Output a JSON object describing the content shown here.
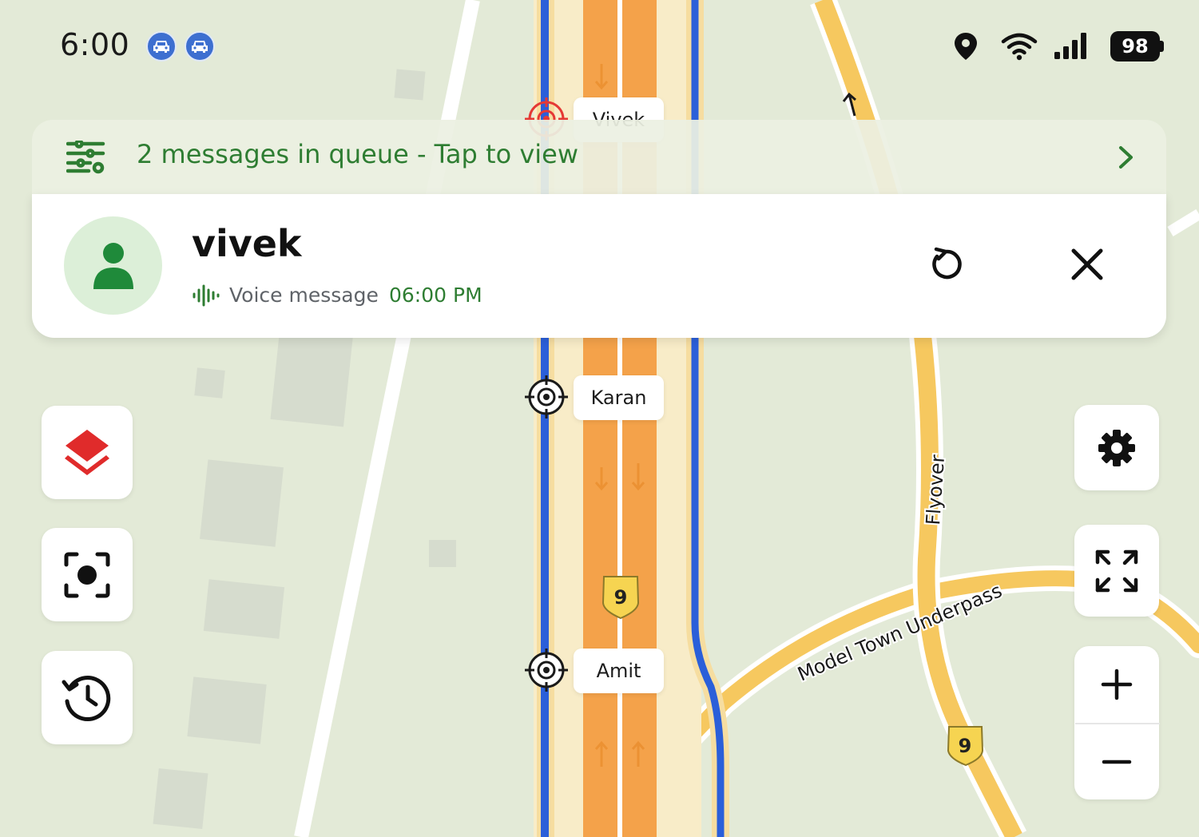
{
  "status_bar": {
    "time": "6:00",
    "notification_icons": [
      "car-icon",
      "car-icon"
    ],
    "battery_level": "98",
    "icons": [
      "location-pin-icon",
      "wifi-icon",
      "signal-icon",
      "battery-icon"
    ]
  },
  "map": {
    "markers": [
      {
        "name": "Vivek",
        "active": true
      },
      {
        "name": "Karan",
        "active": false
      },
      {
        "name": "Amit",
        "active": false
      }
    ],
    "road_labels": {
      "flyover": "Flyover",
      "underpass": "Model Town Underpass",
      "route_shield": "9"
    },
    "colors": {
      "land": "#e3ead7",
      "highway": "#f4a24a",
      "blue_edge": "#2b5fd9",
      "yellow_road": "#f6c85f",
      "active_marker": "#e53935"
    }
  },
  "queue_banner": {
    "text": "2 messages in queue - Tap to view",
    "accent": "#2e7d32"
  },
  "message_card": {
    "sender": "vivek",
    "type": "Voice message",
    "time": "06:00 PM"
  },
  "controls": {
    "left": [
      "layers-icon",
      "recenter-icon",
      "history-icon"
    ],
    "right": [
      "settings-icon",
      "fullscreen-icon",
      "zoom-in-icon",
      "zoom-out-icon"
    ]
  }
}
